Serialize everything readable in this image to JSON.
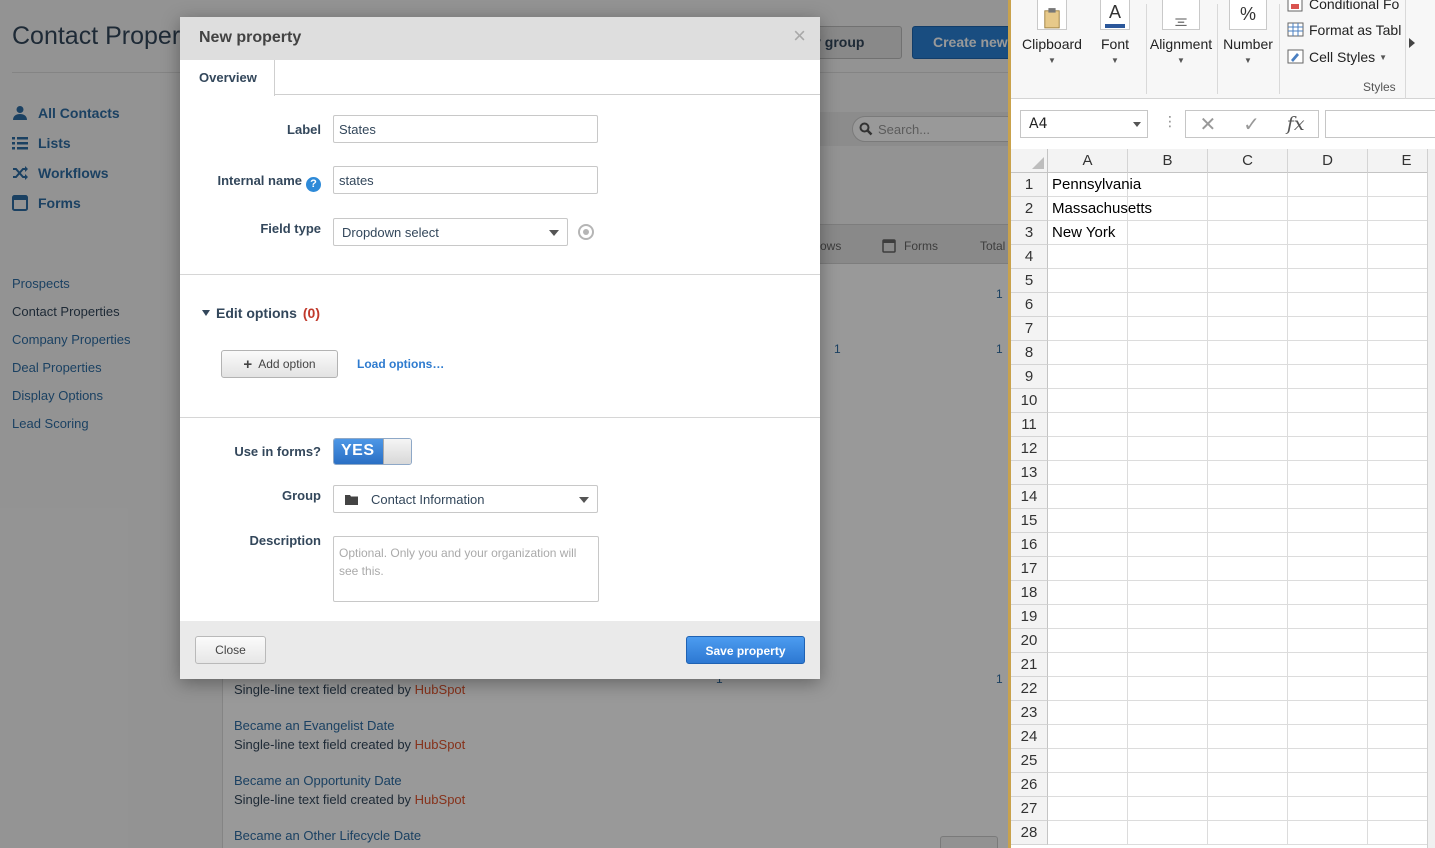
{
  "hubspot": {
    "page_title": "Contact Proper",
    "nav": [
      {
        "label": "All Contacts",
        "icon": "person-icon"
      },
      {
        "label": "Lists",
        "icon": "list-icon"
      },
      {
        "label": "Workflows",
        "icon": "shuffle-icon"
      },
      {
        "label": "Forms",
        "icon": "form-icon"
      }
    ],
    "side_links": [
      "Prospects",
      "Contact Properties",
      "Company Properties",
      "Deal Properties",
      "Display Options",
      "Lead Scoring"
    ],
    "active_side_link": "Contact Properties",
    "btn_group_label": "rty group",
    "btn_create_label": "Create new",
    "search_placeholder": "Search...",
    "table_headers": {
      "workflows": "ows",
      "forms": "Forms",
      "total": "Total"
    },
    "row_numbers": [
      "1",
      "1",
      "1",
      "1",
      "1"
    ],
    "properties": [
      {
        "name": "",
        "desc_prefix": "Single-line text field created by",
        "author": "HubSpot"
      },
      {
        "name": "Became an Evangelist Date",
        "desc_prefix": "Single-line text field created by",
        "author": "HubSpot"
      },
      {
        "name": "Became an Opportunity Date",
        "desc_prefix": "Single-line text field created by",
        "author": "HubSpot"
      },
      {
        "name": "Became an Other Lifecycle Date",
        "desc_prefix": "",
        "author": ""
      }
    ]
  },
  "modal": {
    "title": "New property",
    "close_glyph": "×",
    "tab_overview": "Overview",
    "label_label": "Label",
    "label_value": "States",
    "internal_name_label": "Internal name",
    "internal_name_value": "states",
    "help_glyph": "?",
    "field_type_label": "Field type",
    "field_type_value": "Dropdown select",
    "edit_options_label": "Edit options",
    "options_count": "(0)",
    "add_option_label": "Add option",
    "load_options_label": "Load options…",
    "use_in_forms_label": "Use in forms?",
    "toggle_value": "YES",
    "group_label": "Group",
    "group_value": "Contact Information",
    "description_label": "Description",
    "description_placeholder": "Optional. Only you and your organization will see this.",
    "close_button": "Close",
    "save_button": "Save property"
  },
  "excel": {
    "ribbon": {
      "clipboard": "Clipboard",
      "font": "Font",
      "alignment": "Alignment",
      "number": "Number",
      "number_glyph": "%",
      "font_glyph": "A",
      "conditional_formatting": "Conditional Fo",
      "format_as_table": "Format as Tabl",
      "cell_styles": "Cell Styles",
      "styles_group": "Styles"
    },
    "name_box": "A4",
    "columns": [
      "A",
      "B",
      "C",
      "D",
      "E"
    ],
    "rows": [
      "1",
      "2",
      "3",
      "4",
      "5",
      "6",
      "7",
      "8",
      "9",
      "10",
      "11",
      "12",
      "13",
      "14",
      "15",
      "16",
      "17",
      "18",
      "19",
      "20",
      "21",
      "22",
      "23",
      "24",
      "25",
      "26",
      "27",
      "28"
    ],
    "cells": {
      "A1": "Pennsylvania",
      "A2": "Massachusetts",
      "A3": "New York"
    }
  }
}
